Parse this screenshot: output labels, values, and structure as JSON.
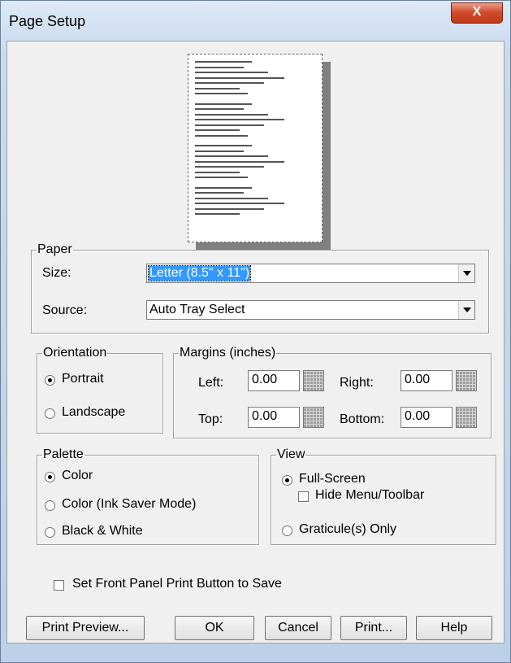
{
  "window": {
    "title": "Page Setup",
    "close_glyph": "X"
  },
  "paper": {
    "legend": "Paper",
    "size_label": "Size:",
    "size_value": "Letter (8.5\" x 11\")",
    "source_label": "Source:",
    "source_value": "Auto Tray Select"
  },
  "orientation": {
    "legend": "Orientation",
    "options": [
      {
        "label": "Portrait",
        "selected": true
      },
      {
        "label": "Landscape",
        "selected": false
      }
    ]
  },
  "margins": {
    "legend": "Margins (inches)",
    "left_label": "Left:",
    "left_value": "0.00",
    "right_label": "Right:",
    "right_value": "0.00",
    "top_label": "Top:",
    "top_value": "0.00",
    "bottom_label": "Bottom:",
    "bottom_value": "0.00"
  },
  "palette": {
    "legend": "Palette",
    "options": [
      {
        "label": "Color",
        "selected": true
      },
      {
        "label": "Color (Ink Saver Mode)",
        "selected": false
      },
      {
        "label": "Black & White",
        "selected": false
      }
    ]
  },
  "view": {
    "legend": "View",
    "full_screen_label": "Full-Screen",
    "full_screen_selected": true,
    "hide_menu_label": "Hide Menu/Toolbar",
    "hide_menu_checked": false,
    "graticule_label": "Graticule(s) Only",
    "graticule_selected": false
  },
  "front_panel_label": "Set Front Panel Print Button to Save",
  "front_panel_checked": false,
  "buttons": {
    "print_preview": "Print Preview...",
    "ok": "OK",
    "cancel": "Cancel",
    "print": "Print...",
    "help": "Help"
  },
  "colors": {
    "selection": "#3399ff",
    "close_button": "#c2381a",
    "dialog_bg": "#f0f0f0"
  }
}
